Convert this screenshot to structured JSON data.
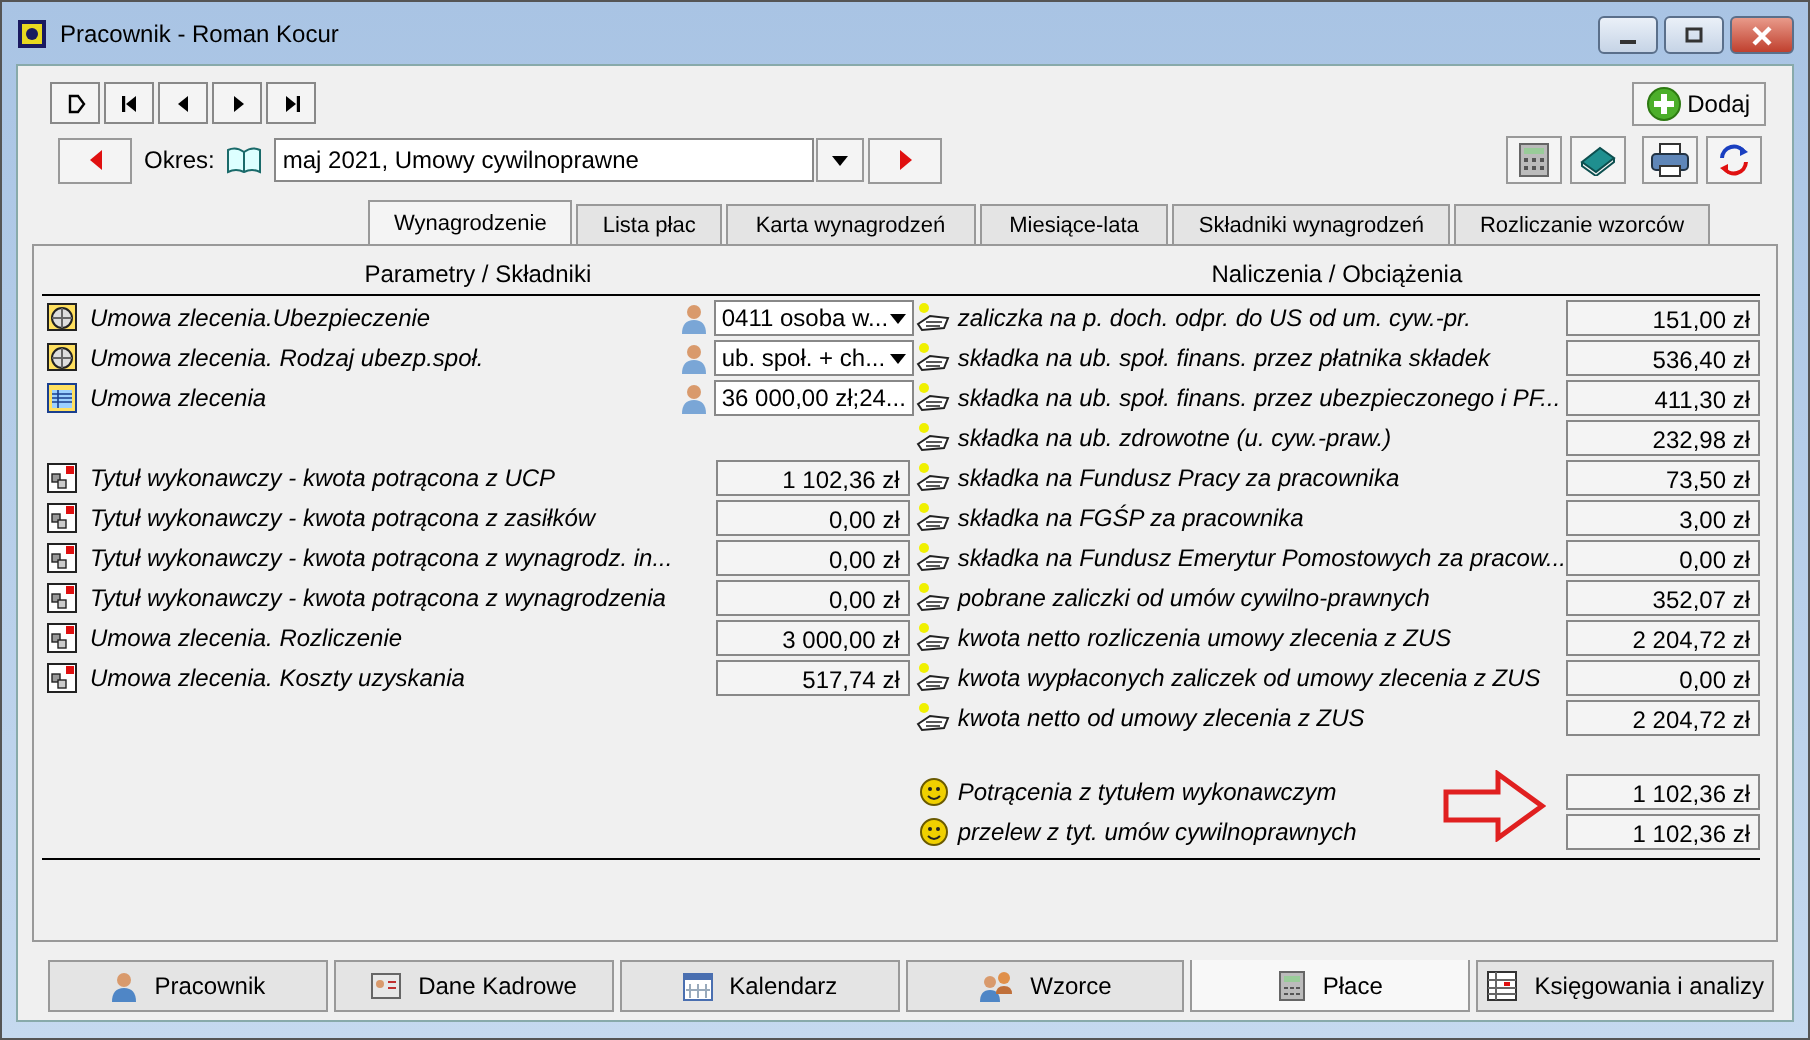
{
  "window": {
    "title": "Pracownik - Roman Kocur"
  },
  "nav_buttons": [
    {
      "kind": "new"
    },
    {
      "kind": "first"
    },
    {
      "kind": "prev"
    },
    {
      "kind": "next"
    },
    {
      "kind": "last"
    }
  ],
  "add_button": "Dodaj",
  "period": {
    "label": "Okres:",
    "value": "maj 2021, Umowy cywilnoprawne"
  },
  "tabs": [
    {
      "label": "Wynagrodzenie",
      "selected": true
    },
    {
      "label": "Lista płac",
      "selected": false
    },
    {
      "label": "Karta wynagrodzeń",
      "selected": false
    },
    {
      "label": "Miesiące-lata",
      "selected": false
    },
    {
      "label": "Składniki wynagrodzeń",
      "selected": false
    },
    {
      "label": "Rozliczanie wzorców",
      "selected": false
    }
  ],
  "parameters": {
    "header": "Parametry / Składniki",
    "selectors": [
      {
        "label": "Umowa zlecenia.Ubezpieczenie",
        "value": "0411 osoba w..."
      },
      {
        "label": "Umowa zlecenia. Rodzaj ubezp.społ.",
        "value": "ub. społ. + ch..."
      },
      {
        "label": "Umowa zlecenia",
        "value": "36 000,00 zł;24..."
      }
    ],
    "amounts": [
      {
        "label": "Tytuł wykonawczy - kwota potrącona z UCP",
        "value": "1 102,36 zł"
      },
      {
        "label": "Tytuł wykonawczy - kwota potrącona z zasiłków",
        "value": "0,00 zł"
      },
      {
        "label": "Tytuł wykonawczy - kwota potrącona z wynagrodz. in...",
        "value": "0,00 zł"
      },
      {
        "label": "Tytuł wykonawczy - kwota potrącona z wynagrodzenia",
        "value": "0,00 zł"
      },
      {
        "label": "Umowa zlecenia. Rozliczenie",
        "value": "3 000,00 zł"
      },
      {
        "label": "Umowa zlecenia. Koszty uzyskania",
        "value": "517,74 zł"
      }
    ]
  },
  "charges": {
    "header": "Naliczenia / Obciążenia",
    "items": [
      {
        "label": "zaliczka na p. doch. odpr. do US od um. cyw.-pr.",
        "value": "151,00 zł"
      },
      {
        "label": "składka na ub. społ. finans. przez płatnika składek",
        "value": "536,40 zł"
      },
      {
        "label": "składka na ub. społ. finans. przez ubezpieczonego i PF...",
        "value": "411,30 zł"
      },
      {
        "label": "składka na ub. zdrowotne (u. cyw.-praw.)",
        "value": "232,98 zł"
      },
      {
        "label": "składka na Fundusz Pracy za pracownika",
        "value": "73,50 zł"
      },
      {
        "label": "składka na FGŚP za pracownika",
        "value": "3,00 zł"
      },
      {
        "label": "składka na Fundusz Emerytur Pomostowych za pracow...",
        "value": "0,00 zł"
      },
      {
        "label": "pobrane zaliczki od umów cywilno-prawnych",
        "value": "352,07 zł"
      },
      {
        "label": "kwota netto rozliczenia umowy zlecenia z ZUS",
        "value": "2 204,72 zł"
      },
      {
        "label": "kwota wypłaconych zaliczek od umowy zlecenia z ZUS",
        "value": "0,00 zł"
      },
      {
        "label": "kwota netto od umowy zlecenia z ZUS",
        "value": "2 204,72 zł"
      }
    ],
    "totals": [
      {
        "label": "Potrącenia z tytułem wykonawczym",
        "value": "1 102,36 zł"
      },
      {
        "label": "przelew z tyt. umów cywilnoprawnych",
        "value": "1 102,36 zł"
      }
    ]
  },
  "bottom_tabs": [
    {
      "label": "Pracownik",
      "selected": false,
      "kind": "person"
    },
    {
      "label": "Dane Kadrowe",
      "selected": false,
      "kind": "card"
    },
    {
      "label": "Kalendarz",
      "selected": false,
      "kind": "calendar"
    },
    {
      "label": "Wzorce",
      "selected": false,
      "kind": "people"
    },
    {
      "label": "Płace",
      "selected": true,
      "kind": "calculator"
    },
    {
      "label": "Księgowania i analizy",
      "selected": false,
      "kind": "ledger"
    }
  ]
}
